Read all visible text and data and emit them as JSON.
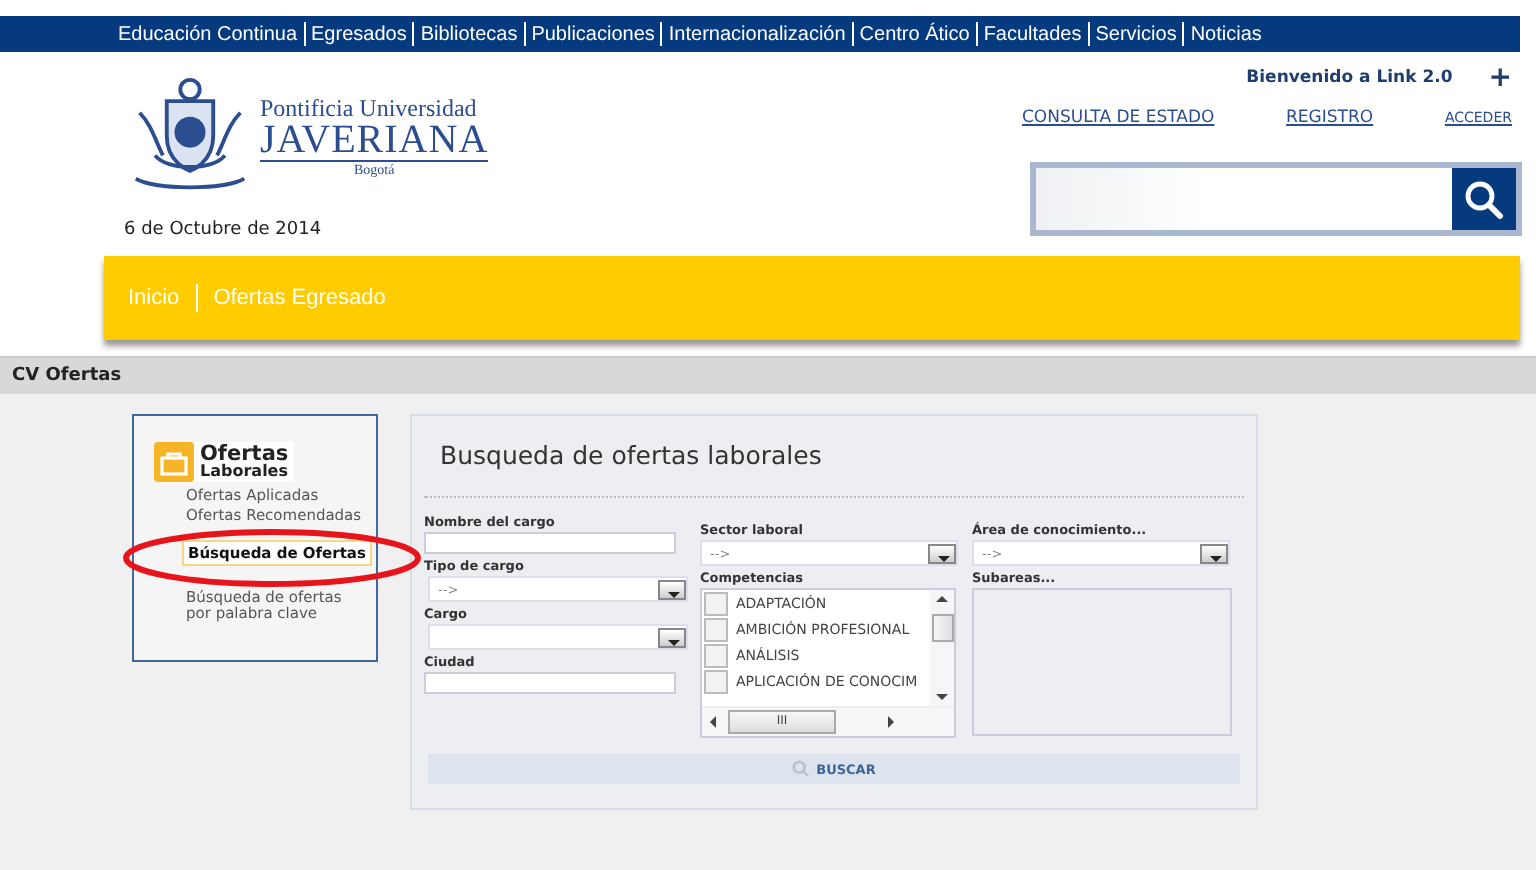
{
  "top_nav": {
    "links": [
      "Educación Continua",
      "Egresados",
      "Bibliotecas",
      "Publicaciones",
      "Internacionalización",
      "Centro Ático",
      "Facultades",
      "Servicios",
      "Noticias"
    ]
  },
  "header": {
    "logo": {
      "line1": "Pontificia Universidad",
      "line2": "JAVERIANA",
      "line3": "Bogotá"
    },
    "date": "6 de Octubre de 2014",
    "welcome": "Bienvenido a Link 2.0",
    "plus": "+",
    "links": [
      "CONSULTA DE ESTADO",
      "REGISTRO",
      "ACCEDER"
    ]
  },
  "breadcrumb": [
    "Inicio",
    "Ofertas Egresado"
  ],
  "section_title": "CV Ofertas",
  "sidebar": {
    "title": "Ofertas",
    "subtitle": "Laborales",
    "items": [
      {
        "label": "Ofertas Aplicadas",
        "selected": false
      },
      {
        "label": "Ofertas Recomendadas",
        "selected": false
      },
      {
        "label": "Búsqueda de Ofertas",
        "selected": true
      },
      {
        "label": "Búsqueda de ofertas por palabra clave",
        "selected": false
      }
    ]
  },
  "form": {
    "title": "Busqueda de ofertas laborales",
    "column_1": [
      {
        "kind": "text",
        "label": "Nombre del cargo"
      },
      {
        "kind": "select",
        "label": "Tipo de cargo",
        "value": "-->"
      },
      {
        "kind": "select",
        "label": "Cargo"
      },
      {
        "kind": "text",
        "label": "Ciudad"
      }
    ],
    "column_2": [
      {
        "kind": "select",
        "label": "Sector laboral",
        "value": "-->"
      },
      {
        "kind": "checklist",
        "label": "Competencias",
        "options": [
          {
            "label": "ADAPTACIÓN",
            "checked": false
          },
          {
            "label": "AMBICIÓN PROFESIONAL",
            "checked": false
          },
          {
            "label": "ANÁLISIS",
            "checked": false
          },
          {
            "label": "APLICACIÓN DE CONOCIM",
            "checked": false
          }
        ],
        "scroll_thumb": "III"
      }
    ],
    "column_3": [
      {
        "kind": "select",
        "label": "Área de conocimiento...",
        "value": "-->"
      },
      {
        "kind": "list",
        "label": "Subareas..."
      }
    ],
    "submit": "BUSCAR"
  }
}
